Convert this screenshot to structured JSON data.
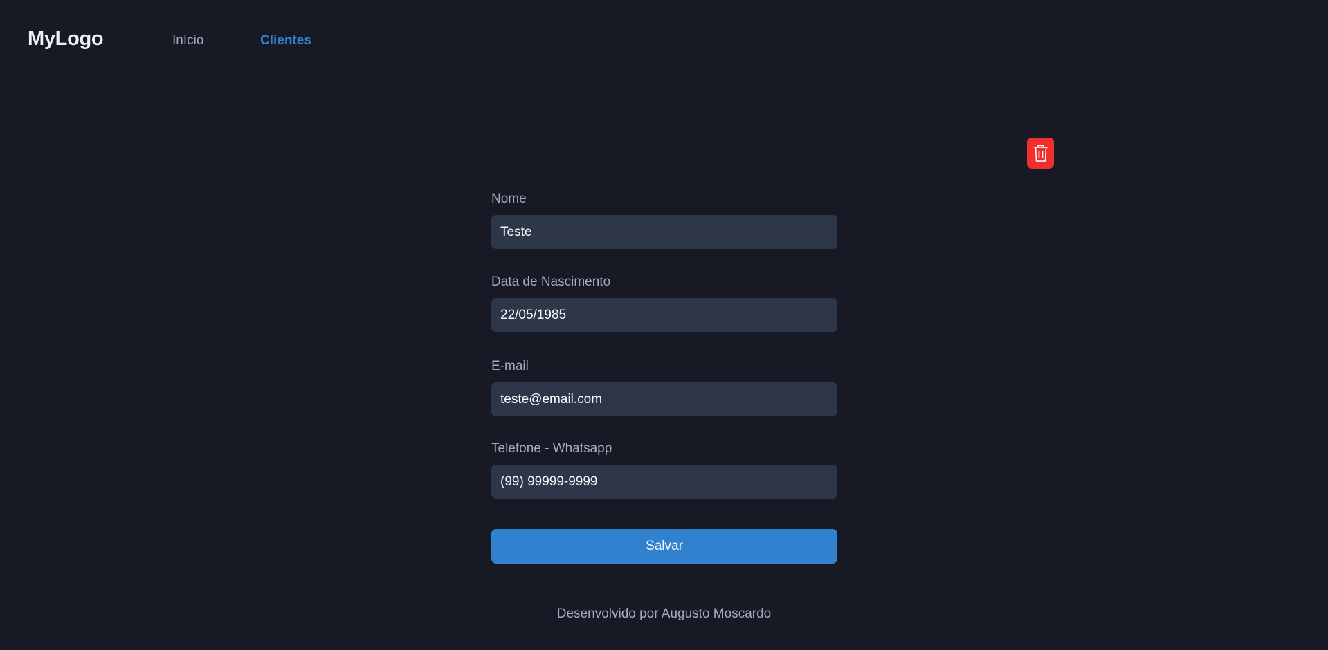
{
  "header": {
    "logo": "MyLogo",
    "nav": [
      {
        "label": "Início",
        "active": false
      },
      {
        "label": "Clientes",
        "active": true
      }
    ]
  },
  "actions": {
    "delete_icon": "trash-icon"
  },
  "form": {
    "fields": [
      {
        "label": "Nome",
        "value": "Teste"
      },
      {
        "label": "Data de Nascimento",
        "value": "22/05/1985"
      },
      {
        "label": "E-mail",
        "value": "teste@email.com"
      },
      {
        "label": "Telefone - Whatsapp",
        "value": "(99) 99999-9999"
      }
    ],
    "submit_label": "Salvar"
  },
  "footer": {
    "text": "Desenvolvido por Augusto Moscardo"
  },
  "colors": {
    "background": "#171a24",
    "input_bg": "#2d3748",
    "accent": "#3182ce",
    "danger": "#f02e2e",
    "muted_text": "#a0aec0"
  }
}
